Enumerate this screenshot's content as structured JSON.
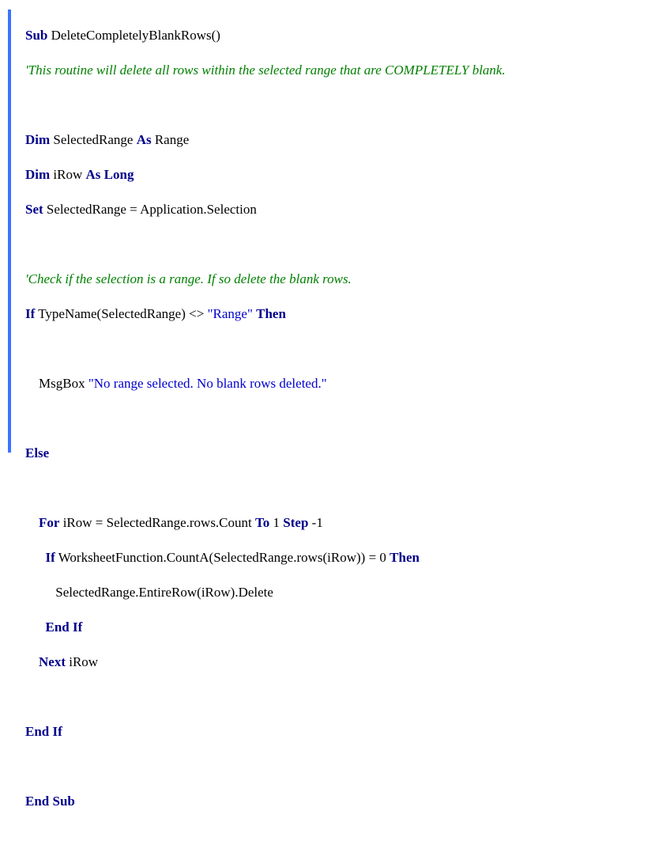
{
  "l1": {
    "sub": "Sub",
    "name": " DeleteCompletelyBlankRows()"
  },
  "l2": "'This routine will delete all rows within the selected range that are COMPLETELY blank.",
  "l4": {
    "dim": "Dim",
    "t1": " SelectedRange ",
    "as": "As",
    "t2": " Range"
  },
  "l5": {
    "dim": "Dim",
    "t1": " iRow ",
    "as": "As",
    "long": " Long"
  },
  "l6": {
    "set": "Set",
    "t1": " SelectedRange = Application.Selection"
  },
  "l8": "'Check if the selection is a range. If so delete the blank rows.",
  "l9": {
    "if": "If",
    "t1": " TypeName(SelectedRange) <> ",
    "str": "\"Range\"",
    "sp": " ",
    "then": "Then"
  },
  "l11": {
    "pre": "    MsgBox ",
    "str": "\"No range selected. No blank rows deleted.\""
  },
  "l13": "Else",
  "l15": {
    "pre": "    ",
    "for": "For",
    "t1": " iRow = SelectedRange.rows.Count ",
    "to": "To",
    "t2": " 1 ",
    "step": "Step",
    "t3": " -1"
  },
  "l16": {
    "pre": "      ",
    "if": "If",
    "t1": " WorksheetFunction.CountA(SelectedRange.rows(iRow)) = 0 ",
    "then": "Then"
  },
  "l17": "         SelectedRange.EntireRow(iRow).Delete",
  "l18": {
    "pre": "      ",
    "endif": "End If"
  },
  "l19": {
    "pre": "    ",
    "next": "Next",
    "t1": " iRow"
  },
  "l21": "End If",
  "l23": "End Sub"
}
